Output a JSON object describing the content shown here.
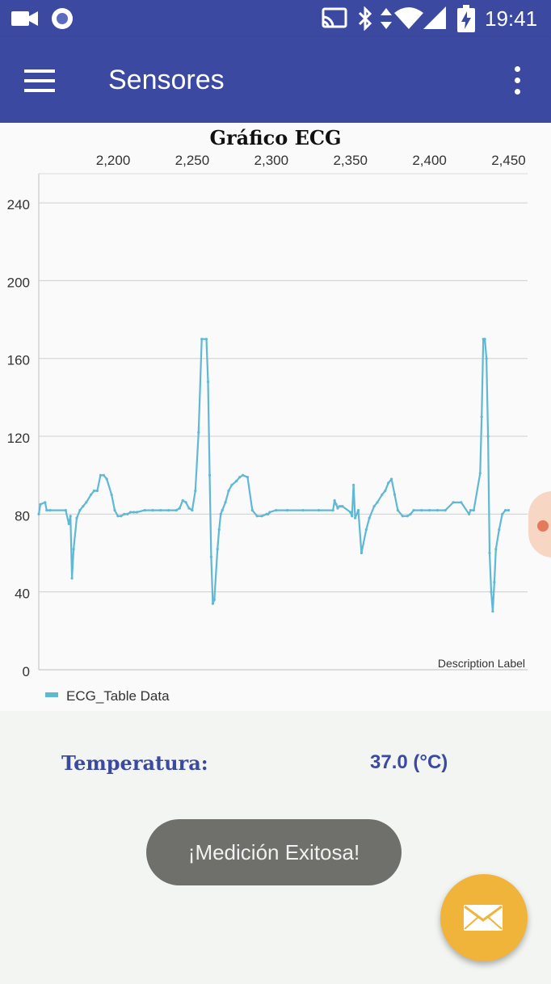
{
  "status_bar": {
    "time": "19:41",
    "icons": [
      "video-camera-icon",
      "record-icon",
      "cast-icon",
      "bluetooth-icon",
      "data-arrows-icon",
      "wifi-icon",
      "signal-icon",
      "battery-charging-icon"
    ]
  },
  "app_bar": {
    "title": "Sensores",
    "menu_icon": "hamburger-menu-icon",
    "overflow_icon": "more-vert-icon"
  },
  "chart_data": {
    "type": "line",
    "title": "Gráfico ECG",
    "x_ticks": [
      "2,200",
      "2,250",
      "2,300",
      "2,350",
      "2,400",
      "2,450"
    ],
    "y_ticks": [
      "0",
      "40",
      "80",
      "120",
      "160",
      "200",
      "240"
    ],
    "xlim": [
      2153,
      2462
    ],
    "ylim": [
      0,
      255
    ],
    "grid": true,
    "description_label": "Description Label",
    "legend_position": "bottom-left",
    "series": [
      {
        "name": "ECG_Table Data",
        "color": "#5fb8d6",
        "x": [
          2153,
          2154,
          2157,
          2158,
          2160,
          2170,
          2172,
          2173,
          2174,
          2175,
          2177,
          2179,
          2181,
          2183,
          2186,
          2188,
          2190,
          2192,
          2194,
          2196,
          2199,
          2201,
          2203,
          2205,
          2207,
          2209,
          2211,
          2213,
          2215,
          2220,
          2225,
          2230,
          2235,
          2240,
          2242,
          2244,
          2246,
          2248,
          2250,
          2252,
          2254,
          2256,
          2259,
          2260,
          2261,
          2262,
          2263,
          2264,
          2266,
          2267,
          2268,
          2269,
          2271,
          2273,
          2275,
          2278,
          2280,
          2282,
          2285,
          2288,
          2291,
          2294,
          2297,
          2298,
          2299,
          2303,
          2310,
          2320,
          2330,
          2339,
          2340,
          2341,
          2342,
          2343,
          2344,
          2345,
          2350,
          2351,
          2352,
          2353,
          2355,
          2357,
          2360,
          2362,
          2365,
          2367,
          2370,
          2372,
          2374,
          2376,
          2378,
          2380,
          2383,
          2386,
          2388,
          2390,
          2395,
          2400,
          2405,
          2410,
          2415,
          2420,
          2425,
          2426,
          2428,
          2432,
          2433,
          2434,
          2435,
          2436,
          2437,
          2438,
          2439,
          2440,
          2441,
          2442,
          2444,
          2446,
          2448,
          2450
        ],
        "values": [
          80,
          85,
          86,
          82,
          82,
          82,
          75,
          79,
          47,
          62,
          78,
          82,
          84,
          86,
          90,
          92,
          92,
          100,
          100,
          98,
          90,
          82,
          79,
          79,
          80,
          80,
          81,
          81,
          81,
          82,
          82,
          82,
          82,
          82,
          83,
          87,
          86,
          83,
          82,
          92,
          122,
          170,
          170,
          148,
          100,
          58,
          34,
          36,
          62,
          72,
          80,
          82,
          86,
          92,
          95,
          97,
          99,
          100,
          99,
          82,
          79,
          79,
          80,
          80,
          81,
          82,
          82,
          82,
          82,
          82,
          87,
          85,
          83,
          84,
          84,
          84,
          81,
          79,
          95,
          78,
          82,
          60,
          72,
          78,
          84,
          86,
          90,
          92,
          96,
          98,
          90,
          82,
          79,
          79,
          80,
          82,
          82,
          82,
          82,
          82,
          86,
          86,
          80,
          82,
          82,
          101,
          130,
          170,
          170,
          160,
          120,
          60,
          40,
          30,
          45,
          62,
          72,
          80,
          82,
          82
        ]
      }
    ]
  },
  "temperature": {
    "label": "Temperatura:",
    "value": "37.0 (°C)"
  },
  "toast": {
    "message": "¡Medición Exitosa!"
  },
  "fab": {
    "icon": "mail-icon",
    "color": "#f1b43a"
  },
  "colors": {
    "primary": "#3b4aa0",
    "accent": "#f1b43a",
    "series": "#5fb8d6"
  }
}
